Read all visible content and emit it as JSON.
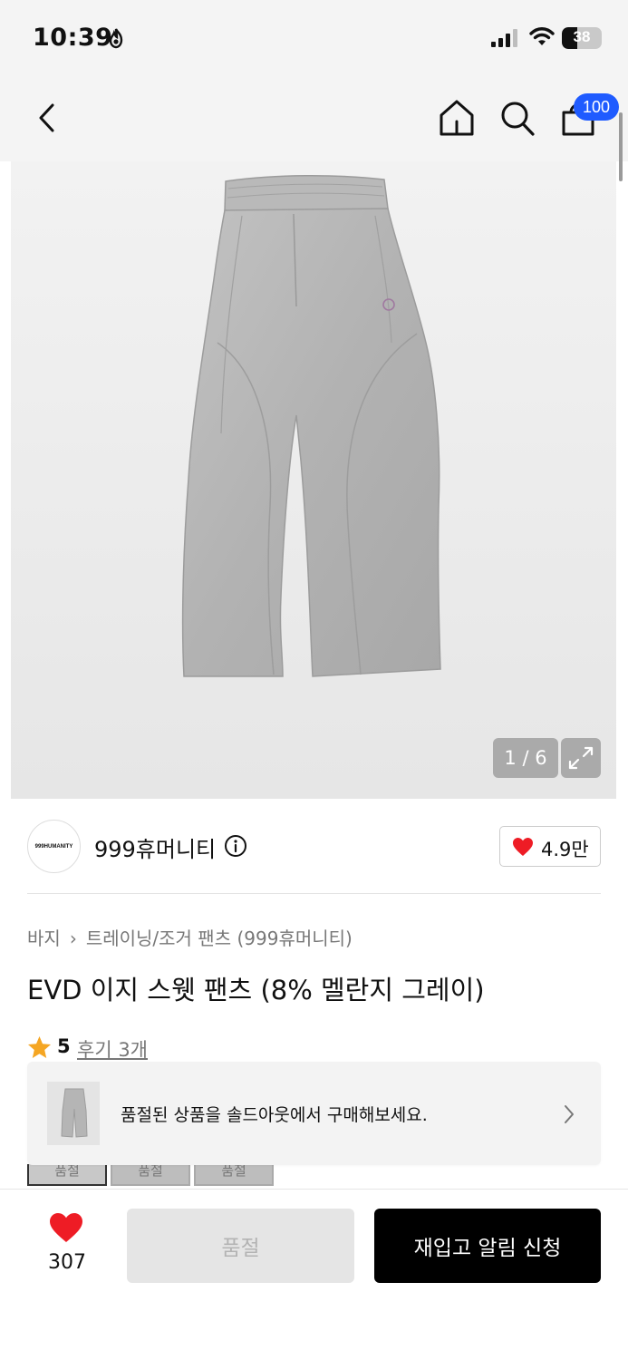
{
  "status_bar": {
    "time": "10:39",
    "battery": "38",
    "battery_level_percent": 38,
    "icons": [
      "flame-icon",
      "signal-icon",
      "wifi-icon",
      "battery-icon"
    ]
  },
  "nav": {
    "icons": [
      "back-arrow-icon",
      "home-icon",
      "search-icon",
      "shopping-bag-icon"
    ],
    "cart_badge": "100"
  },
  "gallery": {
    "page_indicator": "1 / 6",
    "expand_icon": "expand-icon"
  },
  "brand": {
    "logo_text": "999HUMANITY",
    "name": "999휴머니티",
    "like_count": "4.9만",
    "heart_color": "#ee1c25"
  },
  "breadcrumb": {
    "items": [
      "바지",
      "트레이닝/조거 팬츠 (999휴머니티)"
    ]
  },
  "product": {
    "title": "EVD 이지 스웻 팬츠 (8% 멜란지 그레이)",
    "rating": "5",
    "review_link": "후기 3개"
  },
  "option_chips": [
    "품절",
    "품절",
    "품절"
  ],
  "soldout_banner": {
    "text": "품절된 상품을 솔드아웃에서 구매해보세요."
  },
  "bottom_bar": {
    "wish_count": "307",
    "soldout_label": "품절",
    "restock_label": "재입고 알림 신청"
  },
  "colors": {
    "accent_blue": "#1f5bff",
    "heart_red": "#ee1c25",
    "star_orange": "#f5a623",
    "button_black": "#000000"
  }
}
